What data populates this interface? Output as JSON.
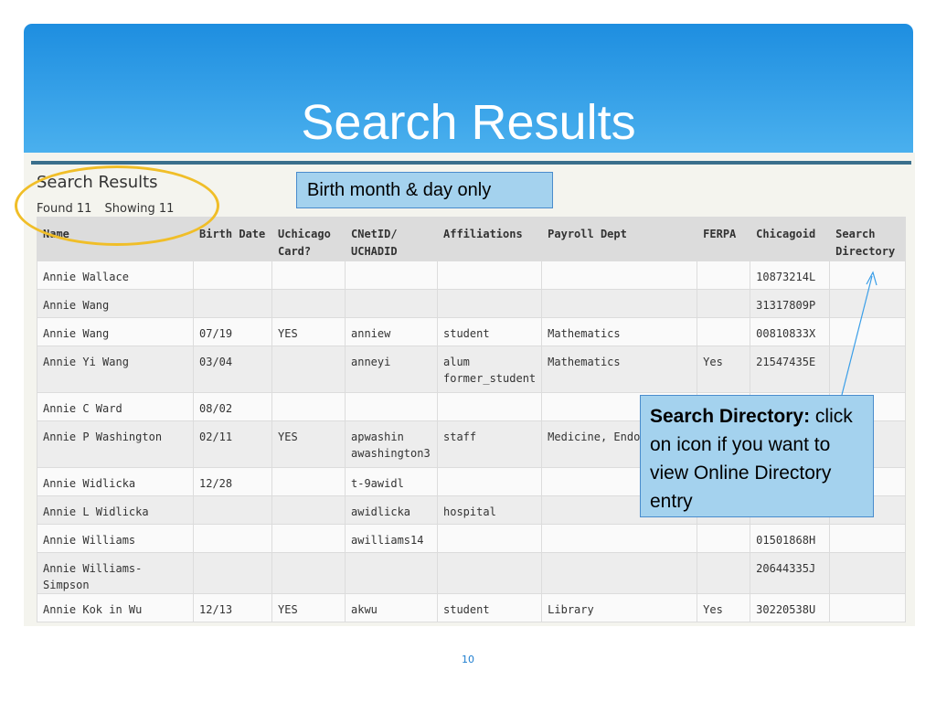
{
  "slide": {
    "title": "Search Results",
    "page_number": "10"
  },
  "results": {
    "heading": "Search Results",
    "found": "Found 11",
    "showing": "Showing 11",
    "columns": [
      {
        "label": "Name"
      },
      {
        "label": "Birth Date"
      },
      {
        "label": "Uchicago Card?"
      },
      {
        "label": "CNetID/ UCHADID"
      },
      {
        "label": "Affiliations"
      },
      {
        "label": "Payroll Dept"
      },
      {
        "label": "FERPA"
      },
      {
        "label": "Chicagoid"
      },
      {
        "label": "Search Directory"
      }
    ],
    "rows": [
      {
        "name": "Annie Wallace",
        "birth": "",
        "card": "",
        "cnet": "",
        "aff": "",
        "dept": "",
        "ferpa": "",
        "cid": "10873214L"
      },
      {
        "name": "Annie Wang",
        "birth": "",
        "card": "",
        "cnet": "",
        "aff": "",
        "dept": "",
        "ferpa": "",
        "cid": "31317809P"
      },
      {
        "name": "Annie Wang",
        "birth": "07/19",
        "card": "YES",
        "cnet": "anniew",
        "aff": "student",
        "dept": "Mathematics",
        "ferpa": "",
        "cid": "00810833X"
      },
      {
        "name": "Annie Yi Wang",
        "birth": "03/04",
        "card": "",
        "cnet": "anneyi",
        "aff": "alum former_student",
        "dept": "Mathematics",
        "ferpa": "Yes",
        "cid": "21547435E"
      },
      {
        "name": "Annie C Ward",
        "birth": "08/02",
        "card": "",
        "cnet": "",
        "aff": "",
        "dept": "",
        "ferpa": "",
        "cid": ""
      },
      {
        "name": "Annie P Washington",
        "birth": "02/11",
        "card": "YES",
        "cnet": "apwashin awashington3",
        "aff": "staff",
        "dept": "Medicine, Endocr",
        "ferpa": "",
        "cid": ""
      },
      {
        "name": "Annie Widlicka",
        "birth": "12/28",
        "card": "",
        "cnet": "t-9awidl",
        "aff": "",
        "dept": "",
        "ferpa": "",
        "cid": ""
      },
      {
        "name": "Annie L Widlicka",
        "birth": "",
        "card": "",
        "cnet": "awidlicka",
        "aff": "hospital",
        "dept": "",
        "ferpa": "",
        "cid": ""
      },
      {
        "name": "Annie Williams",
        "birth": "",
        "card": "",
        "cnet": "awilliams14",
        "aff": "",
        "dept": "",
        "ferpa": "",
        "cid": "01501868H"
      },
      {
        "name": "Annie Williams-Simpson",
        "birth": "",
        "card": "",
        "cnet": "",
        "aff": "",
        "dept": "",
        "ferpa": "",
        "cid": "20644335J"
      },
      {
        "name": "Annie Kok in Wu",
        "birth": "12/13",
        "card": "YES",
        "cnet": "akwu",
        "aff": "student",
        "dept": "Library",
        "ferpa": "Yes",
        "cid": "30220538U"
      }
    ]
  },
  "callouts": {
    "birth": "Birth month & day only",
    "directory_title": "Search Directory:",
    "directory_body": "click on icon if you want to view Online Directory entry"
  },
  "colors": {
    "accent": "#2b91e6",
    "highlight_ring": "#f0be28",
    "callout_bg": "#a4d2ee",
    "link": "#2b67a4"
  }
}
